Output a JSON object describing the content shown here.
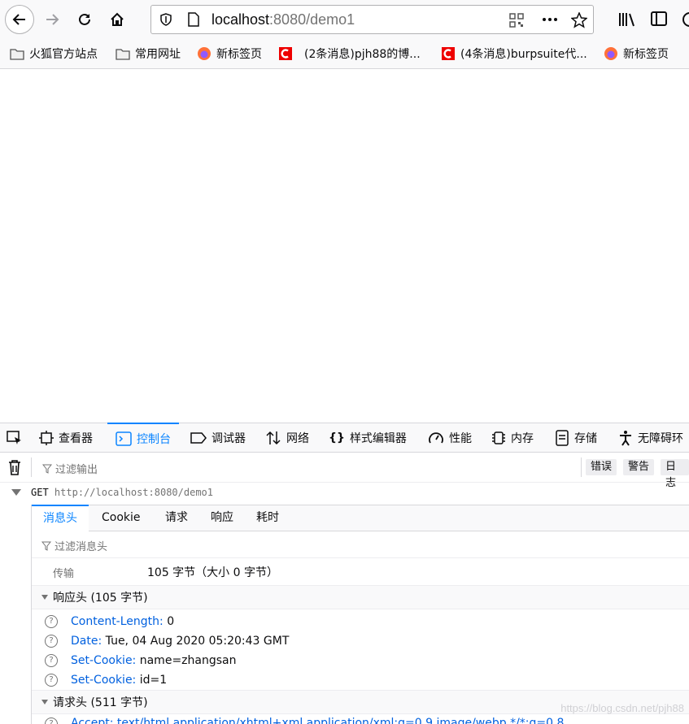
{
  "url": {
    "host": "localhost",
    "rest": ":8080/demo1"
  },
  "bookmarks": [
    {
      "label": "火狐官方站点",
      "icon": "folder-icon"
    },
    {
      "label": "常用网址",
      "icon": "folder-icon"
    },
    {
      "label": "新标签页",
      "icon": "firefox-icon"
    },
    {
      "label": "(2条消息)pjh88的博...",
      "icon": "csdn-icon"
    },
    {
      "label": "(4条消息)burpsuite代...",
      "icon": "csdn-icon"
    },
    {
      "label": "新标签页",
      "icon": "firefox-icon"
    }
  ],
  "devtools": {
    "tabs": [
      "查看器",
      "控制台",
      "调试器",
      "网络",
      "样式编辑器",
      "性能",
      "内存",
      "存储",
      "无障碍环"
    ],
    "active_tab": "控制台",
    "filter_placeholder": "过滤输出",
    "severity": [
      "错误",
      "警告",
      "日志"
    ],
    "request": {
      "method": "GET",
      "url": "http://localhost:8080/demo1"
    },
    "panel_tabs": [
      "消息头",
      "Cookie",
      "请求",
      "响应",
      "耗时"
    ],
    "header_filter_placeholder": "过滤消息头",
    "transfer_label": "传输",
    "transfer_value": "105 字节（大小 0 字节）",
    "response_headers_title": "响应头 (105 字节)",
    "response_headers": [
      {
        "name": "Content-Length:",
        "value": "0"
      },
      {
        "name": "Date:",
        "value": "Tue, 04 Aug 2020 05:20:43 GMT"
      },
      {
        "name": "Set-Cookie:",
        "value": "name=zhangsan"
      },
      {
        "name": "Set-Cookie:",
        "value": "id=1"
      }
    ],
    "request_headers_title": "请求头 (511 字节)",
    "request_header_partial": "Accept: text/html,application/xhtml+xml,application/xml;q=0.9,image/webp,*/*;q=0.8"
  },
  "watermark": "https://blog.csdn.net/pjh88"
}
